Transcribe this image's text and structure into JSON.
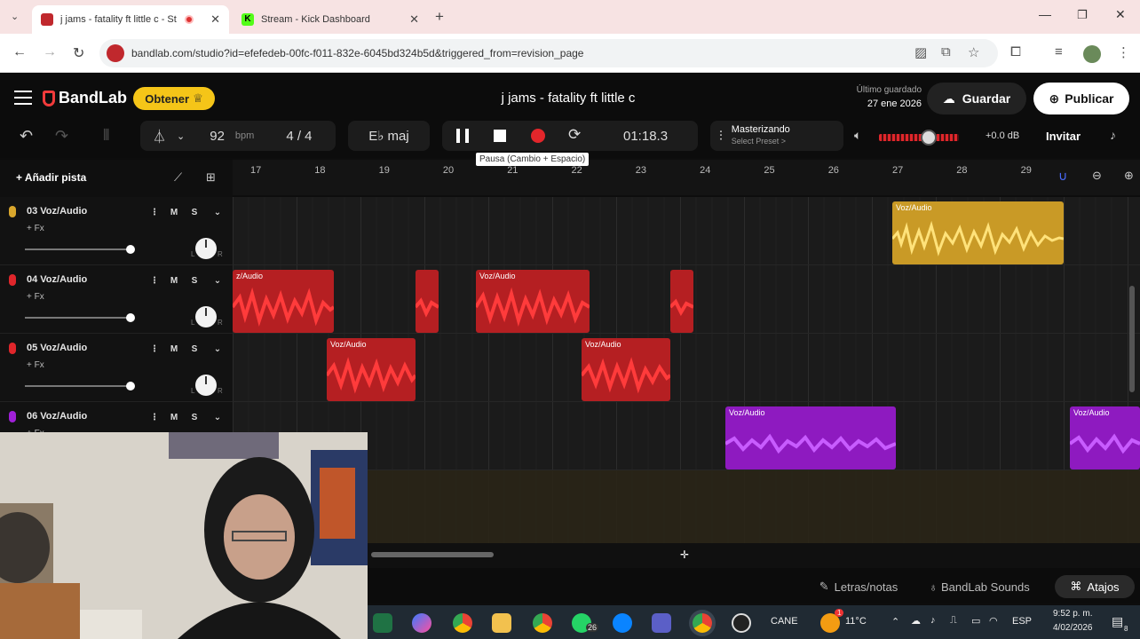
{
  "browser": {
    "tabs": [
      {
        "title": "j jams - fatality ft little c - St",
        "active": true
      },
      {
        "title": "Stream - Kick Dashboard",
        "active": false
      }
    ],
    "new_tab": "+",
    "url": "bandlab.com/studio?id=efefedeb-00fc-f011-832e-6045bd324b5d&triggered_from=revision_page"
  },
  "app": {
    "logo": "BandLab",
    "get_button": "Obtener",
    "project_title": "j jams - fatality ft little c",
    "last_saved_label": "Último guardado",
    "last_saved_date": "27 ene 2026",
    "save_button": "Guardar",
    "publish_button": "Publicar"
  },
  "toolbar": {
    "bpm_value": "92",
    "bpm_unit": "bpm",
    "time_signature": "4 / 4",
    "key": "E♭ maj",
    "time": "01:18.3",
    "tooltip": "Pausa (Cambio + Espacio)",
    "mastering_title": "Masterizando",
    "mastering_preset": "Select Preset >",
    "volume_db": "+0.0 dB",
    "invite_button": "Invitar",
    "volume_level": 0.62
  },
  "timeline": {
    "add_track": "Añadir pista",
    "bars": [
      "17",
      "18",
      "19",
      "20",
      "21",
      "22",
      "23",
      "24",
      "25",
      "26",
      "27",
      "28",
      "29"
    ]
  },
  "tracks": [
    {
      "name": "03 Voz/Audio",
      "fx": "+ Fx",
      "mute": "M",
      "solo": "S",
      "color": "#d9a62c",
      "clips": [
        {
          "label": "Voz/Audio"
        }
      ]
    },
    {
      "name": "04 Voz/Audio",
      "fx": "+ Fx",
      "mute": "M",
      "solo": "S",
      "color": "#e0262b",
      "clips": [
        {
          "label": "z/Audio"
        },
        {
          "label": ""
        },
        {
          "label": "Voz/Audio"
        },
        {
          "label": ""
        }
      ]
    },
    {
      "name": "05 Voz/Audio",
      "fx": "+ Fx",
      "mute": "M",
      "solo": "S",
      "color": "#e0262b",
      "clips": [
        {
          "label": "Voz/Audio"
        },
        {
          "label": "Voz/Audio"
        }
      ]
    },
    {
      "name": "06 Voz/Audio",
      "fx": "+ Fx",
      "mute": "M",
      "solo": "S",
      "color": "#a020d8",
      "clips": [
        {
          "label": "Voz/Audio"
        },
        {
          "label": "Voz/Audio"
        }
      ]
    }
  ],
  "pan_labels": {
    "left": "L",
    "right": "R"
  },
  "bottom": {
    "lyrics": "Letras/notas",
    "sounds": "BandLab Sounds",
    "shortcuts": "Atajos"
  },
  "taskbar": {
    "cane": "CANE",
    "temperature": "11°C",
    "language": "ESP",
    "time": "9:52 p. m.",
    "date": "4/02/2026",
    "whatsapp_badge": "26",
    "weather_badge": "1",
    "notif_badge": "8"
  },
  "colors": {
    "accent_red": "#e0262b",
    "gold": "#f5c518",
    "purple": "#a020d8",
    "orange": "#d9a62c"
  }
}
